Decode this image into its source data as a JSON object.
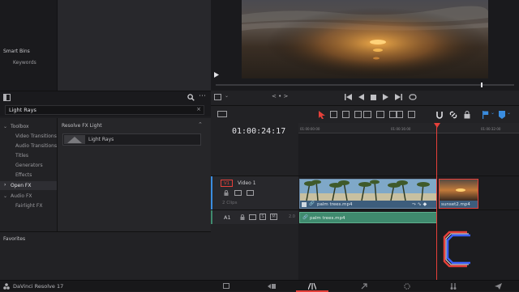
{
  "media_pool": {
    "smart_bins_title": "Smart Bins",
    "keywords_label": "Keywords"
  },
  "effects": {
    "search_value": "Light Rays",
    "tree": [
      {
        "label": "Toolbox",
        "expanded": true
      },
      {
        "label": "Video Transitions"
      },
      {
        "label": "Audio Transitions"
      },
      {
        "label": "Titles"
      },
      {
        "label": "Generators"
      },
      {
        "label": "Effects"
      },
      {
        "label": "Open FX",
        "selected": true
      },
      {
        "label": "Audio FX",
        "expanded": true
      },
      {
        "label": "Fairlight FX"
      }
    ],
    "category_header": "Resolve FX Light",
    "result_item": "Light Rays",
    "favorites_label": "Favorites"
  },
  "viewer": {
    "nav_dots": "< • >"
  },
  "timeline": {
    "timecode": "01:00:24:17",
    "ruler": [
      "01:00:00:00",
      "01:00:16:00",
      "01:00:32:00"
    ],
    "tracks": {
      "v1_label": "V1",
      "v1_name": "Video 1",
      "v1_clips": "2 Clips",
      "a1_label": "A1",
      "a1_level": "2.0"
    },
    "clips": {
      "video1_name": "palm trees.mp4",
      "video2_name": "sunset2.mp4",
      "audio1_name": "palm trees.mp4"
    },
    "accent_playhead": "#e6403a"
  },
  "status_bar": {
    "app_name": "DaVinci Resolve 17"
  },
  "colors": {
    "video_clip": "#3d5d7c",
    "audio_clip": "#3f8a6e",
    "accent_blue": "#3a8de0"
  }
}
